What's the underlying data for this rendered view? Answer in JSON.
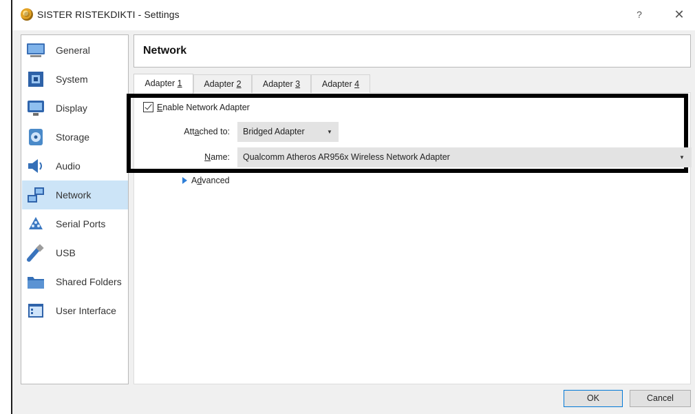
{
  "window": {
    "title": "SISTER RISTEKDIKTI - Settings",
    "help_glyph": "?",
    "close_glyph": "✕"
  },
  "sidebar": {
    "items": [
      {
        "label": "General",
        "icon": "general-icon",
        "selected": false
      },
      {
        "label": "System",
        "icon": "system-icon",
        "selected": false
      },
      {
        "label": "Display",
        "icon": "display-icon",
        "selected": false
      },
      {
        "label": "Storage",
        "icon": "storage-icon",
        "selected": false
      },
      {
        "label": "Audio",
        "icon": "audio-icon",
        "selected": false
      },
      {
        "label": "Network",
        "icon": "network-icon",
        "selected": true
      },
      {
        "label": "Serial Ports",
        "icon": "serial-ports-icon",
        "selected": false
      },
      {
        "label": "USB",
        "icon": "usb-icon",
        "selected": false
      },
      {
        "label": "Shared Folders",
        "icon": "shared-folders-icon",
        "selected": false
      },
      {
        "label": "User Interface",
        "icon": "user-interface-icon",
        "selected": false
      }
    ]
  },
  "header": {
    "title": "Network"
  },
  "tabs": [
    {
      "prefix": "Adapter ",
      "key": "1",
      "active": true
    },
    {
      "prefix": "Adapter ",
      "key": "2",
      "active": false
    },
    {
      "prefix": "Adapter ",
      "key": "3",
      "active": false
    },
    {
      "prefix": "Adapter ",
      "key": "4",
      "active": false
    }
  ],
  "adapter": {
    "enable": {
      "key": "E",
      "rest": "nable Network Adapter",
      "checked": true
    },
    "attached_to": {
      "pre": "Att",
      "key": "a",
      "post": "ched to:",
      "value": "Bridged Adapter"
    },
    "name": {
      "key": "N",
      "post": "ame:",
      "value": "Qualcomm Atheros AR956x Wireless Network Adapter"
    },
    "advanced": {
      "key": "d",
      "pre": "A",
      "post": "vanced"
    }
  },
  "buttons": {
    "ok": "OK",
    "cancel": "Cancel"
  },
  "colors": {
    "selection": "#cce4f7",
    "highlight_frame": "#000000",
    "accent": "#0078d7"
  }
}
